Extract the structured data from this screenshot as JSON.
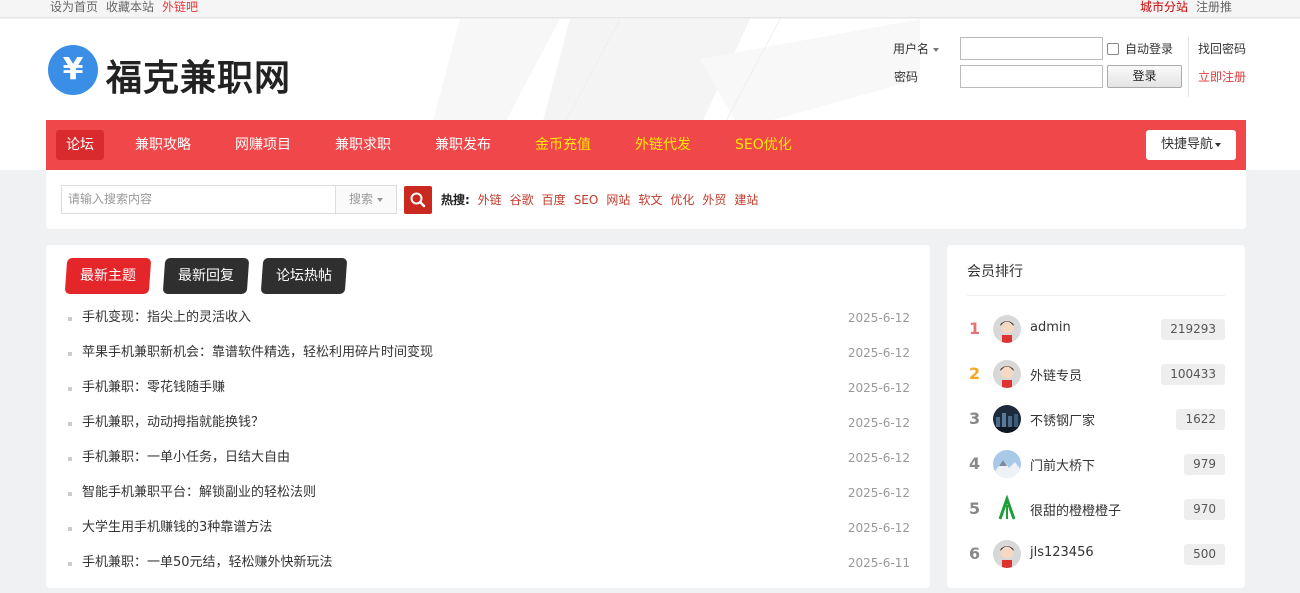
{
  "topbar": {
    "left_links": [
      "设为首页",
      "收藏本站"
    ],
    "left_highlight": "外链吧",
    "right_highlight": "城市分站",
    "right_link": "注册推"
  },
  "logo": {
    "symbol": "¥",
    "text": "福克兼职网"
  },
  "login": {
    "username_label": "用户名",
    "password_label": "密码",
    "username_value": "",
    "password_value": "",
    "auto_login_label": "自动登录",
    "login_button": "登录",
    "forgot_password": "找回密码",
    "register": "立即注册"
  },
  "nav": {
    "items": [
      {
        "label": "论坛",
        "style": "active"
      },
      {
        "label": "兼职攻略",
        "style": "normal"
      },
      {
        "label": "网赚项目",
        "style": "normal"
      },
      {
        "label": "兼职求职",
        "style": "normal"
      },
      {
        "label": "兼职发布",
        "style": "normal"
      },
      {
        "label": "金币充值",
        "style": "yellow"
      },
      {
        "label": "外链代发",
        "style": "yellow"
      },
      {
        "label": "SEO优化",
        "style": "yellow"
      }
    ],
    "quick_nav": "快捷导航"
  },
  "search": {
    "placeholder": "请输入搜索内容",
    "select_label": "搜索",
    "hot_label": "热搜:",
    "hot_keywords": [
      "外链",
      "谷歌",
      "百度",
      "SEO",
      "网站",
      "软文",
      "优化",
      "外贸",
      "建站"
    ]
  },
  "tabs": [
    "最新主题",
    "最新回复",
    "论坛热帖"
  ],
  "threads": [
    {
      "title": "手机变现：指尖上的灵活收入",
      "date": "2025-6-12"
    },
    {
      "title": "苹果手机兼职新机会：靠谱软件精选，轻松利用碎片时间变现",
      "date": "2025-6-12"
    },
    {
      "title": "手机兼职：零花钱随手赚",
      "date": "2025-6-12"
    },
    {
      "title": "手机兼职，动动拇指就能换钱？",
      "date": "2025-6-12"
    },
    {
      "title": "手机兼职：一单小任务，日结大自由",
      "date": "2025-6-12"
    },
    {
      "title": "智能手机兼职平台：解锁副业的轻松法则",
      "date": "2025-6-12"
    },
    {
      "title": "大学生用手机赚钱的3种靠谱方法",
      "date": "2025-6-12"
    },
    {
      "title": "手机兼职：一单50元结，轻松赚外快新玩法",
      "date": "2025-6-11"
    }
  ],
  "ranking": {
    "title": "会员排行",
    "members": [
      {
        "rank": "1",
        "name": "admin",
        "score": "219293",
        "avatar": "default-avatar"
      },
      {
        "rank": "2",
        "name": "外链专员",
        "score": "100433",
        "avatar": "default-avatar"
      },
      {
        "rank": "3",
        "name": "不锈钢厂家",
        "score": "1622",
        "avatar": "city-night-avatar"
      },
      {
        "rank": "4",
        "name": "门前大桥下",
        "score": "979",
        "avatar": "mountain-avatar"
      },
      {
        "rank": "5",
        "name": "很甜的橙橙橙子",
        "score": "970",
        "avatar": "green-logo-avatar"
      },
      {
        "rank": "6",
        "name": "jls123456",
        "score": "500",
        "avatar": "default-avatar"
      }
    ]
  },
  "colors": {
    "nav_red": "#f0474a",
    "active_red": "#d92a2e",
    "nav_yellow": "#ffea00",
    "search_button": "#c9291f",
    "tab_dark": "#2f2f2f"
  }
}
